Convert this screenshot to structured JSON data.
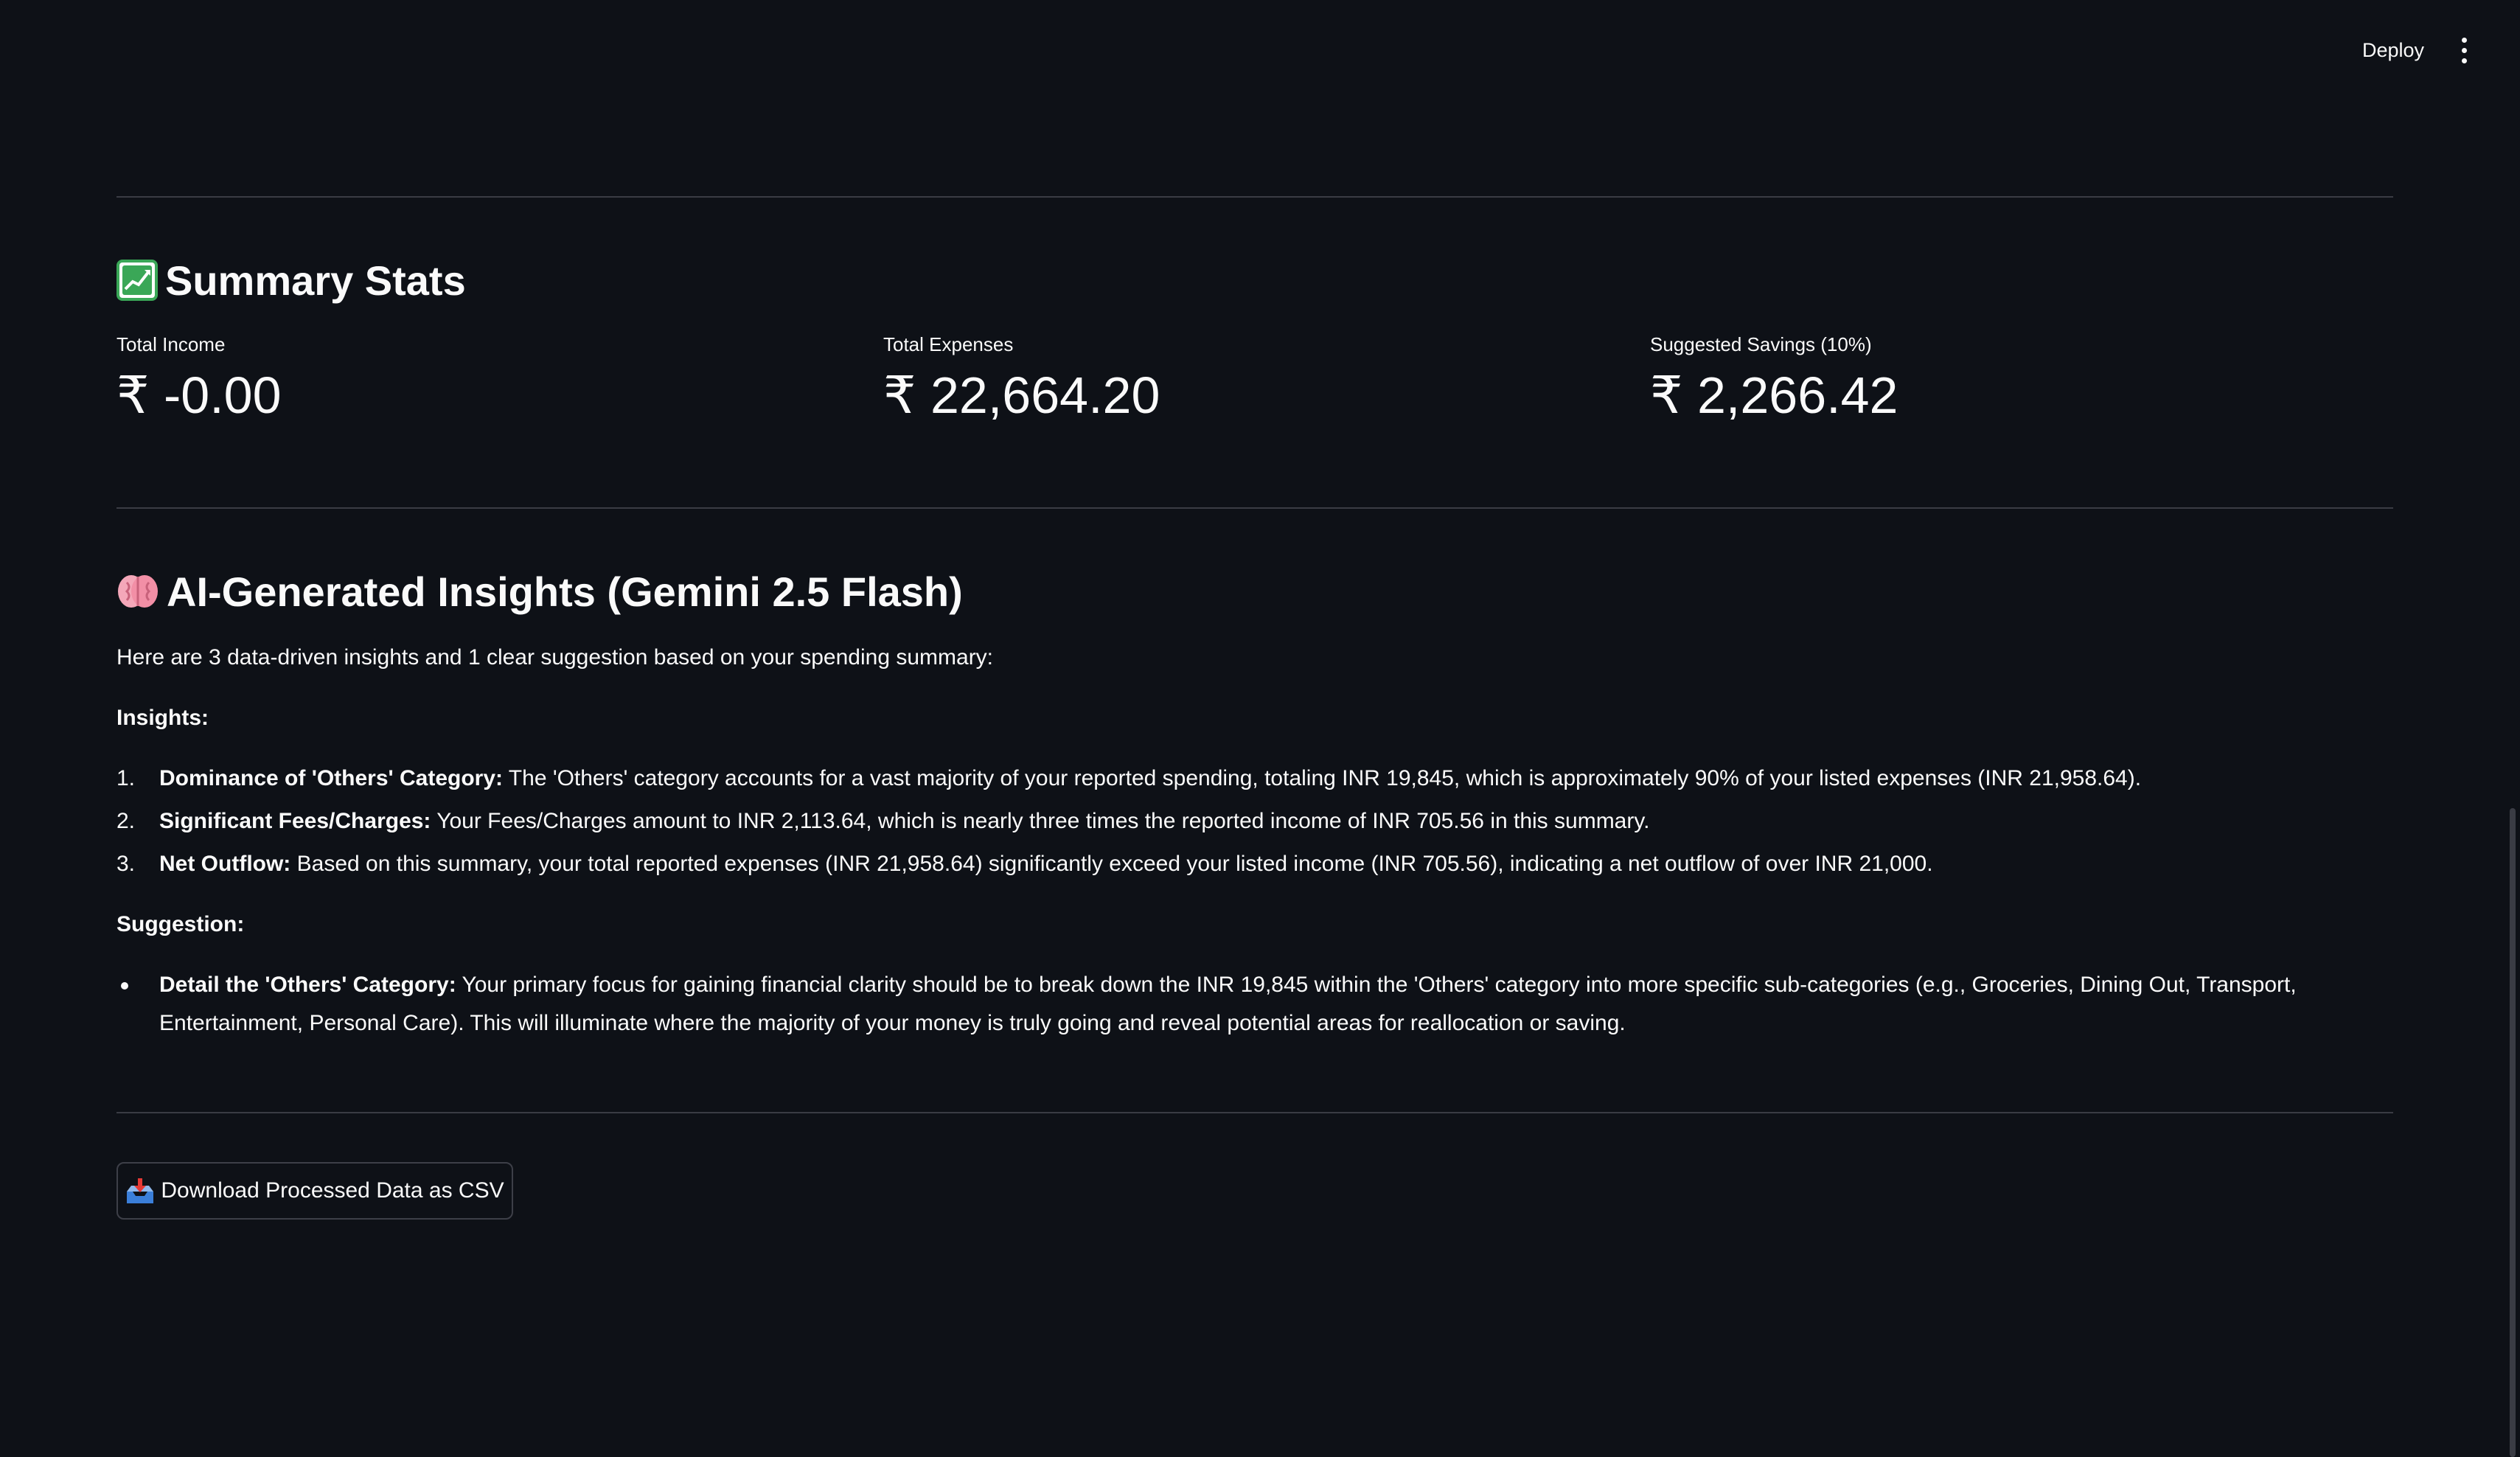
{
  "header": {
    "deploy_label": "Deploy",
    "menu_icon": "kebab-menu-icon"
  },
  "summary": {
    "title": "Summary Stats",
    "icon": "chart-increasing-icon",
    "metrics": [
      {
        "label": "Total Income",
        "value": "₹ -0.00"
      },
      {
        "label": "Total Expenses",
        "value": "₹ 22,664.20"
      },
      {
        "label": "Suggested Savings (10%)",
        "value": "₹ 2,266.42"
      }
    ]
  },
  "insights": {
    "title": "AI-Generated Insights (Gemini 2.5 Flash)",
    "icon": "brain-icon",
    "intro": "Here are 3 data-driven insights and 1 clear suggestion based on your spending summary:",
    "insights_heading": "Insights:",
    "items": [
      {
        "num": "1.",
        "bold": "Dominance of 'Others' Category:",
        "text": " The 'Others' category accounts for a vast majority of your reported spending, totaling INR 19,845, which is approximately 90% of your listed expenses (INR 21,958.64)."
      },
      {
        "num": "2.",
        "bold": "Significant Fees/Charges:",
        "text": " Your Fees/Charges amount to INR 2,113.64, which is nearly three times the reported income of INR 705.56 in this summary."
      },
      {
        "num": "3.",
        "bold": "Net Outflow:",
        "text": " Based on this summary, your total reported expenses (INR 21,958.64) significantly exceed your listed income (INR 705.56), indicating a net outflow of over INR 21,000."
      }
    ],
    "suggestion_heading": "Suggestion:",
    "suggestion": {
      "bold": "Detail the 'Others' Category:",
      "text": " Your primary focus for gaining financial clarity should be to break down the INR 19,845 within the 'Others' category into more specific sub-categories (e.g., Groceries, Dining Out, Transport, Entertainment, Personal Care). This will illuminate where the majority of your money is truly going and reveal potential areas for reallocation or saving."
    }
  },
  "download": {
    "label": "Download Processed Data as CSV",
    "icon": "inbox-tray-icon"
  },
  "colors": {
    "background": "#0e1117",
    "text": "#fafafa",
    "divider": "#3a3c44"
  }
}
